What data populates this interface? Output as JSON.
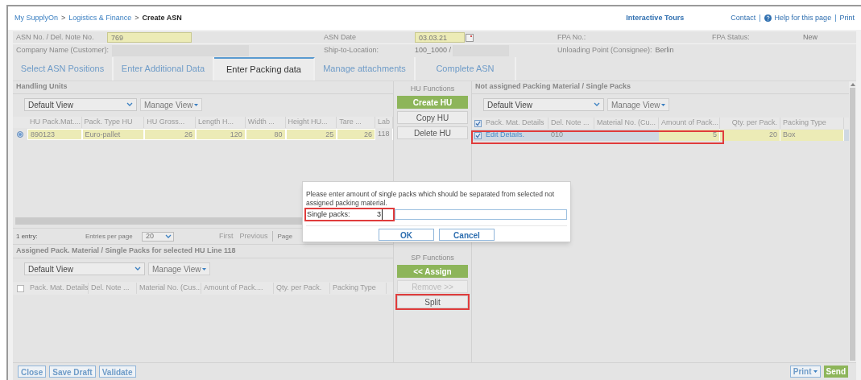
{
  "breadcrumb": {
    "links": [
      "My SupplyOn",
      "Logistics & Finance"
    ],
    "separator": ">",
    "current": "Create ASN"
  },
  "top_links": {
    "tours": "Interactive Tours",
    "separator": "|",
    "items": [
      {
        "label": "Contact",
        "kind": "plain"
      },
      {
        "label": "Help for this page",
        "kind": "help"
      },
      {
        "label": "Print",
        "kind": "plain"
      }
    ]
  },
  "header_fields": [
    [
      {
        "label": "ASN No. / Del. Note No.",
        "value": "769",
        "kind": "input"
      },
      {
        "label": "ASN Date",
        "value": "03.03.21",
        "kind": "date"
      },
      {
        "label": "FPA No.:",
        "kind": "text"
      },
      {
        "label": "FPA Status:",
        "value": "New",
        "kind": "text"
      }
    ],
    [
      {
        "label": "Company Name (Customer):",
        "kind": "blank"
      },
      {
        "label": "Ship-to-Location:",
        "value": "100_1000 /",
        "kind": "blank"
      },
      {
        "label": "Unloading Point (Consignee):",
        "value": "Berlin",
        "kind": "text"
      }
    ]
  ],
  "tabs": [
    {
      "label": "Select ASN Positions",
      "selected": false
    },
    {
      "label": "Enter Additional Data",
      "selected": false
    },
    {
      "label": "Enter Packing data",
      "selected": true
    },
    {
      "label": "Manage attachments",
      "selected": false
    },
    {
      "label": "Complete ASN",
      "selected": false
    }
  ],
  "handling_units": {
    "title": "Handling Units",
    "view": "Default View",
    "manage": "Manage View",
    "columns": [
      {
        "label": "HU Pack.Mat....",
        "editable": true
      },
      {
        "label": "Pack. Type HU",
        "editable": true
      },
      {
        "label": "HU Gross...",
        "editable": true
      },
      {
        "label": "Length H...",
        "editable": true
      },
      {
        "label": "Width ...",
        "editable": true
      },
      {
        "label": "Height HU...",
        "editable": true
      },
      {
        "label": "Tare ...",
        "editable": true
      },
      {
        "label": "Lab",
        "editable": false
      }
    ],
    "rows": [
      {
        "selected": true,
        "cells": [
          "890123",
          "Euro-pallet",
          "26",
          "120",
          "80",
          "25",
          "26",
          "118"
        ]
      }
    ],
    "pager": {
      "count": "1 entry:",
      "per_page_label": "Entries per page",
      "per_page": "20",
      "first": "First",
      "previous": "Previous",
      "page": "Page"
    }
  },
  "assigned": {
    "title": "Assigned Pack. Material / Single Packs for selected HU Line 118",
    "view": "Default View",
    "manage": "Manage View",
    "all_checked": false,
    "columns": [
      "Pack. Mat. Details",
      "Del. Note ...",
      "Material No. (Cus...",
      "Amount of Pack....",
      "Qty. per Pack.",
      "Packing Type"
    ]
  },
  "hu_functions": {
    "title": "HU Functions",
    "buttons": [
      {
        "label": "Create HU",
        "kind": "primary",
        "disabled": false,
        "highlighted": false
      },
      {
        "label": "Copy HU",
        "kind": "normal",
        "disabled": false,
        "highlighted": false
      },
      {
        "label": "Delete HU",
        "kind": "normal",
        "disabled": false,
        "highlighted": false
      }
    ]
  },
  "sp_functions": {
    "title": "SP Functions",
    "buttons": [
      {
        "label": "<< Assign",
        "kind": "primary",
        "disabled": false,
        "highlighted": false
      },
      {
        "label": "Remove >>",
        "kind": "normal",
        "disabled": true,
        "highlighted": false
      },
      {
        "label": "Split",
        "kind": "normal",
        "disabled": false,
        "highlighted": true
      }
    ]
  },
  "not_assigned": {
    "title": "Not assigned Packing Material / Single Packs",
    "view": "Default View",
    "manage": "Manage View",
    "all_checked": true,
    "columns": [
      {
        "label": "Pack. Mat. Details",
        "editable": false
      },
      {
        "label": "Del. Note ...",
        "editable": false
      },
      {
        "label": "Material No. (Cu...",
        "editable": false
      },
      {
        "label": "Amount of Pack...",
        "editable": true
      },
      {
        "label": "Qty. per Pack.",
        "editable": true
      },
      {
        "label": "Packing Type",
        "editable": true
      }
    ],
    "rows": [
      {
        "checked": true,
        "selected": true,
        "highlighted": true,
        "cells": [
          "Edit Details.",
          "010",
          "",
          "5",
          "20",
          "Box"
        ]
      }
    ]
  },
  "dialog": {
    "message": "Please enter amount of single packs which should be separated from selected not assigned packing material.",
    "field_label": "Single packs:",
    "field_value": "3",
    "highlighted": true,
    "ok": "OK",
    "cancel": "Cancel"
  },
  "footer": {
    "left": [
      "Close",
      "Save Draft",
      "Validate"
    ],
    "print": "Print",
    "send": "Send"
  }
}
